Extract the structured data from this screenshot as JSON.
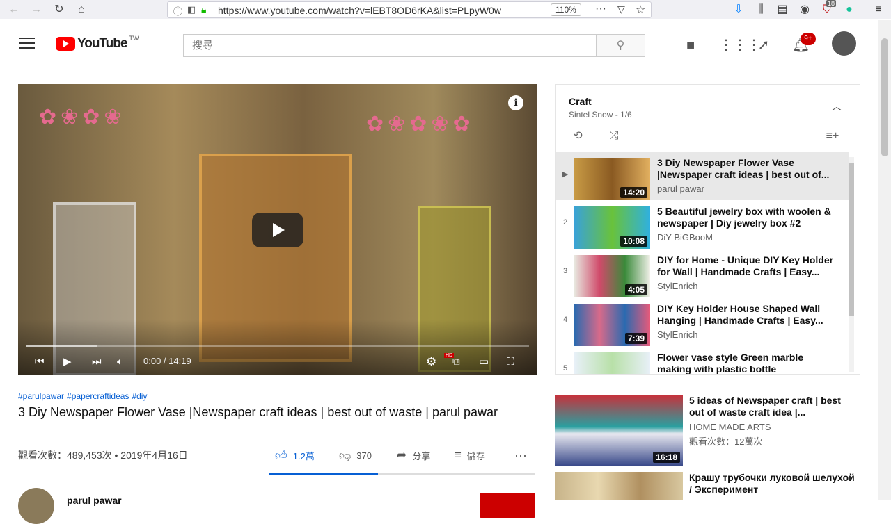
{
  "browser": {
    "url": "https://www.youtube.com/watch?v=lEBT8OD6rKA&list=PLpyW0w",
    "zoom": "110%",
    "ext_badge_count": "18"
  },
  "header": {
    "logo_text": "YouTube",
    "logo_region": "TW",
    "search_placeholder": "搜尋",
    "notification_count": "9+"
  },
  "player": {
    "current_time": "0:00 / 14:19",
    "hd_label": "HD",
    "progress_buffered": 0.14
  },
  "video": {
    "hashtags": [
      "#parulpawar",
      "#papercraftideas",
      "#diy"
    ],
    "title": "3 Diy Newspaper Flower Vase |Newspaper craft ideas | best out of waste | parul pawar",
    "views_date": "觀看次數：489,453次 • 2019年4月16日",
    "likes": "1.2萬",
    "dislikes": "370",
    "share_label": "分享",
    "save_label": "儲存",
    "like_ratio": 0.41,
    "channel_name": "parul pawar"
  },
  "playlist": {
    "title": "Craft",
    "subtitle": "Sintel Snow - 1/6",
    "items": [
      {
        "index": "▶",
        "title": "3 Diy Newspaper Flower Vase |Newspaper craft ideas | best out of...",
        "channel": "parul pawar",
        "duration": "14:20",
        "active": true
      },
      {
        "index": "2",
        "title": "5 Beautiful jewelry box with woolen & newspaper | Diy jewelry box #2",
        "channel": "DiY BiGBooM",
        "duration": "10:08",
        "active": false
      },
      {
        "index": "3",
        "title": "DIY for Home - Unique DIY Key Holder for Wall | Handmade Crafts | Easy...",
        "channel": "StylEnrich",
        "duration": "4:05",
        "active": false
      },
      {
        "index": "4",
        "title": "DIY Key Holder House Shaped Wall Hanging | Handmade Crafts | Easy...",
        "channel": "StylEnrich",
        "duration": "7:39",
        "active": false
      },
      {
        "index": "5",
        "title": "Flower vase style Green marble making with plastic bottle",
        "channel": "",
        "duration": "",
        "active": false
      }
    ]
  },
  "recommended": [
    {
      "title": "5 ideas of Newspaper craft | best out of waste craft idea |...",
      "channel": "HOME MADE ARTS",
      "meta": "觀看次數：12萬次",
      "duration": "16:18"
    },
    {
      "title": "Крашу трубочки луковой шелухой / Эксперимент",
      "channel": "",
      "meta": "",
      "duration": ""
    }
  ],
  "colors": {
    "brand_red": "#ff0000",
    "link_blue": "#065fd4",
    "subscribe_red": "#cc0000"
  }
}
